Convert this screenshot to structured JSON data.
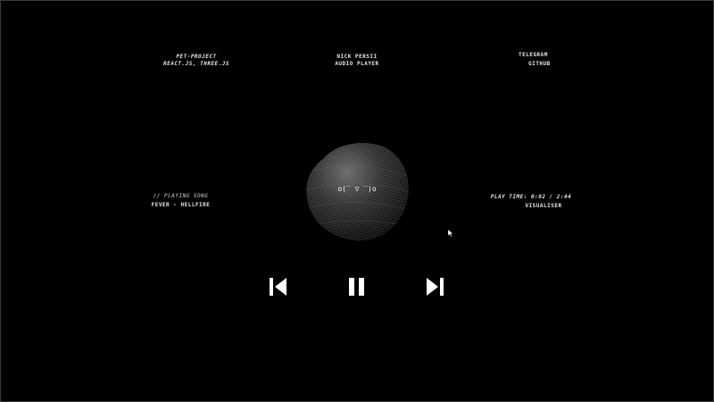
{
  "header": {
    "left": {
      "line1": "PET-PROJECT",
      "line2": "REACT.JS, THREE.JS"
    },
    "center": {
      "line1": "NICK PERSII",
      "line2": "AUDIO PLAYER"
    },
    "right": {
      "link1": "TELEGRAM",
      "link2": "GITHUB"
    }
  },
  "now_playing": {
    "label": "// PLAYING SONG",
    "song": "FEVER - HELLFIRE"
  },
  "status": {
    "play_time": "PLAY TIME: 0:02 / 2:44",
    "mode": "VISUALISER"
  },
  "visualizer": {
    "face": "o(‾ ▽ ‾)o",
    "sphere_icon": "wireframe-sphere-icon"
  },
  "controls": {
    "prev_icon": "skip-previous-icon",
    "pause_icon": "pause-icon",
    "next_icon": "skip-next-icon"
  },
  "colors": {
    "background": "#000000",
    "foreground": "#ffffff"
  }
}
